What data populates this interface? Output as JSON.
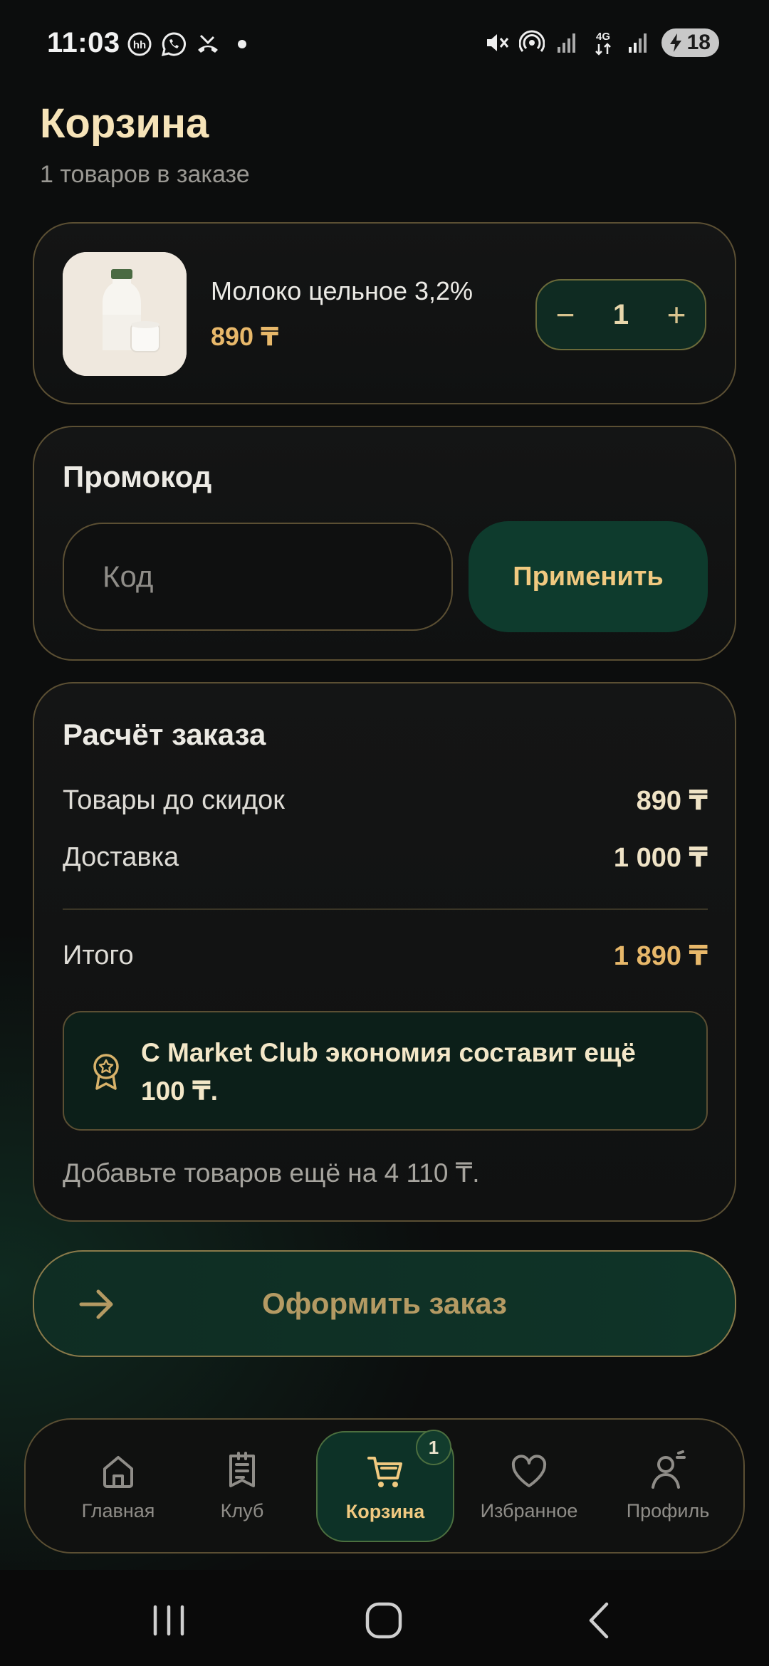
{
  "status_bar": {
    "time": "11:03",
    "left_icons": [
      "hh-icon",
      "whatsapp-icon",
      "missed-call-icon",
      "dot-icon"
    ],
    "right_icons": [
      "mute-icon",
      "hotspot-icon",
      "signal-icon",
      "4g-icon",
      "signal-icon-2"
    ],
    "network_label": "4G",
    "battery_level": "18"
  },
  "header": {
    "title": "Корзина",
    "subtitle": "1 товаров в заказе"
  },
  "cart_items": [
    {
      "name": "Молоко цельное 3,2%",
      "price": "890 ₸",
      "quantity": "1",
      "minus_label": "−",
      "plus_label": "+",
      "image_icon": "milk-bottle-image"
    }
  ],
  "promo": {
    "title": "Промокод",
    "input_placeholder": "Код",
    "input_value": "",
    "apply_label": "Применить"
  },
  "summary": {
    "title": "Расчёт заказа",
    "rows": [
      {
        "label": "Товары до скидок",
        "value": "890 ₸"
      },
      {
        "label": "Доставка",
        "value": "1 000 ₸"
      }
    ],
    "total_label": "Итого",
    "total_value": "1 890 ₸",
    "club_banner": "С Market Club экономия составит ещё 100 ₸.",
    "club_icon": "award-badge-icon",
    "hint": "Добавьте товаров ещё на 4 110 ₸."
  },
  "checkout": {
    "label": "Оформить заказ",
    "icon": "arrow-right-icon"
  },
  "bottom_nav": {
    "items": [
      {
        "label": "Главная",
        "icon": "home-icon"
      },
      {
        "label": "Клуб",
        "icon": "club-icon"
      },
      {
        "label": "Корзина",
        "icon": "cart-icon",
        "active": true,
        "badge": "1"
      },
      {
        "label": "Избранное",
        "icon": "heart-icon"
      },
      {
        "label": "Профиль",
        "icon": "profile-icon"
      }
    ]
  },
  "colors": {
    "accent_gold": "#e8b86a",
    "title_cream": "#f6e3b8",
    "accent_green": "#0e3b2d",
    "border_gold": "#5b4f33",
    "background": "#0c0d0d"
  }
}
